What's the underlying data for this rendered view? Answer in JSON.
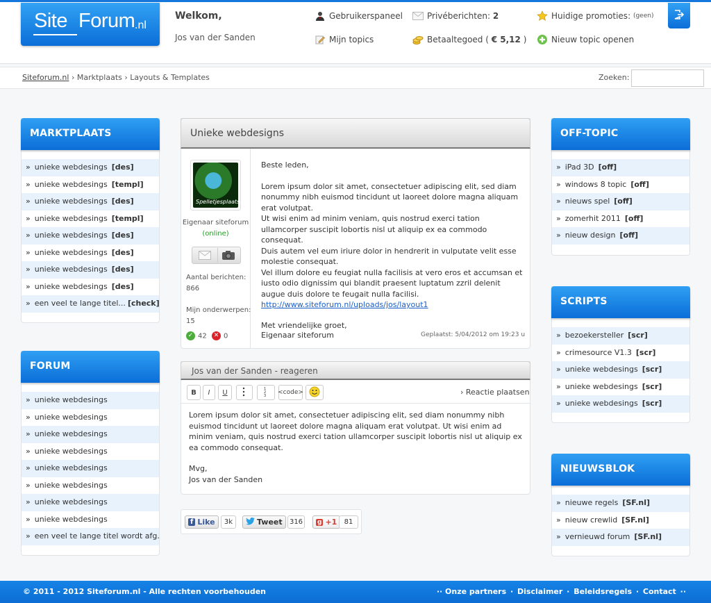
{
  "header": {
    "logo": {
      "part1": "Site",
      "part2": "Forum",
      "part3": ".nl"
    },
    "welcome": "Welkom,",
    "username": "Jos van der Sanden",
    "links": {
      "userpanel": "Gebruikerspaneel",
      "my_topics": "Mijn topics",
      "private_msgs": "Privéberichten:",
      "private_count": "2",
      "balance": "Betaaltegoed (",
      "balance_value": "€ 5,12",
      "balance_close": ")",
      "promotions": "Huidige promoties:",
      "promotions_value": "(geen)",
      "new_topic": "Nieuw topic openen"
    }
  },
  "breadcrumb": {
    "home": "Siteforum.nl",
    "sep": "›",
    "level1": "Marktplaats",
    "level2": "Layouts & Templates"
  },
  "search": {
    "label": "Zoeken:",
    "value": ""
  },
  "left": {
    "marktplaats": {
      "title": "MARKTPLAATS",
      "items": [
        {
          "label": "unieke webdesings",
          "tag": "[des]"
        },
        {
          "label": "unieke webdesings",
          "tag": "[templ]"
        },
        {
          "label": "unieke webdesings",
          "tag": "[des]"
        },
        {
          "label": "unieke webdesings",
          "tag": "[templ]"
        },
        {
          "label": "unieke webdesings",
          "tag": "[des]"
        },
        {
          "label": "unieke webdesings",
          "tag": "[des]"
        },
        {
          "label": "unieke webdesings",
          "tag": "[des]"
        },
        {
          "label": "unieke webdesings",
          "tag": "[des]"
        },
        {
          "label": "een veel te lange titel...",
          "tag": "[check]"
        }
      ]
    },
    "forum": {
      "title": "FORUM",
      "items": [
        {
          "label": "unieke webdesings"
        },
        {
          "label": "unieke webdesings"
        },
        {
          "label": "unieke webdesings"
        },
        {
          "label": "unieke webdesings"
        },
        {
          "label": "unieke webdesings"
        },
        {
          "label": "unieke webdesings"
        },
        {
          "label": "unieke webdesings"
        },
        {
          "label": "unieke webdesings"
        },
        {
          "label": "een veel te lange titel wordt afg..."
        }
      ]
    }
  },
  "right": {
    "offtopic": {
      "title": "OFF-TOPIC",
      "items": [
        {
          "label": "iPad 3D",
          "tag": "[off]"
        },
        {
          "label": "windows 8 topic",
          "tag": "[off]"
        },
        {
          "label": "nieuws spel",
          "tag": "[off]"
        },
        {
          "label": "zomerhit 2011",
          "tag": "[off]"
        },
        {
          "label": "nieuw design",
          "tag": "[off]"
        }
      ]
    },
    "scripts": {
      "title": "SCRIPTS",
      "items": [
        {
          "label": "bezoekersteller",
          "tag": "[scr]"
        },
        {
          "label": "crimesource V1.3",
          "tag": "[scr]"
        },
        {
          "label": "unieke webdesings",
          "tag": "[scr]"
        },
        {
          "label": "unieke webdesings",
          "tag": "[scr]"
        },
        {
          "label": "unieke webdesings",
          "tag": "[scr]"
        }
      ]
    },
    "news": {
      "title": "NIEUWSBLOK",
      "items": [
        {
          "label": "nieuwe regels",
          "tag": "[SF.nl]"
        },
        {
          "label": "nieuw crewlid",
          "tag": "[SF.nl]"
        },
        {
          "label": "vernieuwd forum",
          "tag": "[SF.nl]"
        }
      ]
    }
  },
  "post": {
    "title": "Unieke webdesigns",
    "author": {
      "avatar_caption": "Spelletjesplaats.be",
      "role": "Eigenaar siteforum",
      "status": "(online)",
      "posts_label": "Aantal berichten:",
      "posts_count": "866",
      "topics_label": "Mijn onderwerpen:",
      "topics_count": "15",
      "votes_up": "42",
      "votes_down": "0"
    },
    "greeting": "Beste leden,",
    "body1": "Lorem ipsum dolor sit amet, consectetuer adipiscing elit, sed diam nonummy nibh euismod tincidunt ut laoreet dolore magna aliquam erat volutpat.",
    "body2": "Ut wisi enim ad minim veniam, quis nostrud exerci tation ullamcorper suscipit lobortis nisl ut aliquip ex ea commodo consequat.",
    "body3": "Duis autem vel eum iriure dolor in hendrerit in vulputate velit esse molestie consequat.",
    "body4": "Vel illum dolore eu feugiat nulla facilisis at vero eros et accumsan et iusto odio dignissim qui blandit praesent luptatum zzril delenit augue duis dolore te feugait nulla facilisi.",
    "link": "http://www.siteforum.nl/uploads/jos/layout1",
    "closing": "Met vriendelijke groet,",
    "signature": "Eigenaar siteforum",
    "posted": "Geplaatst: 5/04/2012 om 19:23 u"
  },
  "reply": {
    "title": "Jos van der Sanden - reageren",
    "toolbar": {
      "bold": "B",
      "italic": "I",
      "underline": "U",
      "code": "<code>",
      "submit": "› Reactie plaatsen"
    },
    "text1": "Lorem ipsum dolor sit amet, consectetuer adipiscing elit, sed diam nonummy nibh euismod tincidunt ut laoreet dolore magna aliquam erat volutpat. Ut wisi enim ad minim veniam, quis nostrud exerci tation ullamcorper suscipit lobortis nisl ut aliquip ex ea commodo consequat.",
    "text2": "Mvg,",
    "text3": "Jos van der Sanden"
  },
  "social": {
    "like": "Like",
    "like_count": "3k",
    "tweet": "Tweet",
    "tweet_count": "316",
    "plus": "+1",
    "plus_count": "81"
  },
  "footer": {
    "copyright": "© 2011 - 2012  Siteforum.nl  - Alle rechten voorbehouden",
    "links": [
      "·· Onze partners",
      "·",
      "Disclaimer",
      "·",
      "Beleidsregels",
      "·",
      "Contact",
      "··"
    ]
  },
  "colors": {
    "accent": "#1576dc",
    "light_row": "#e7f2fc",
    "online": "#2a9a2a"
  },
  "icons": [
    "user-icon",
    "edit-icon",
    "mail-icon",
    "coins-icon",
    "star-icon",
    "plus-icon",
    "logout-icon",
    "smiley-icon",
    "check-icon",
    "cross-icon"
  ]
}
